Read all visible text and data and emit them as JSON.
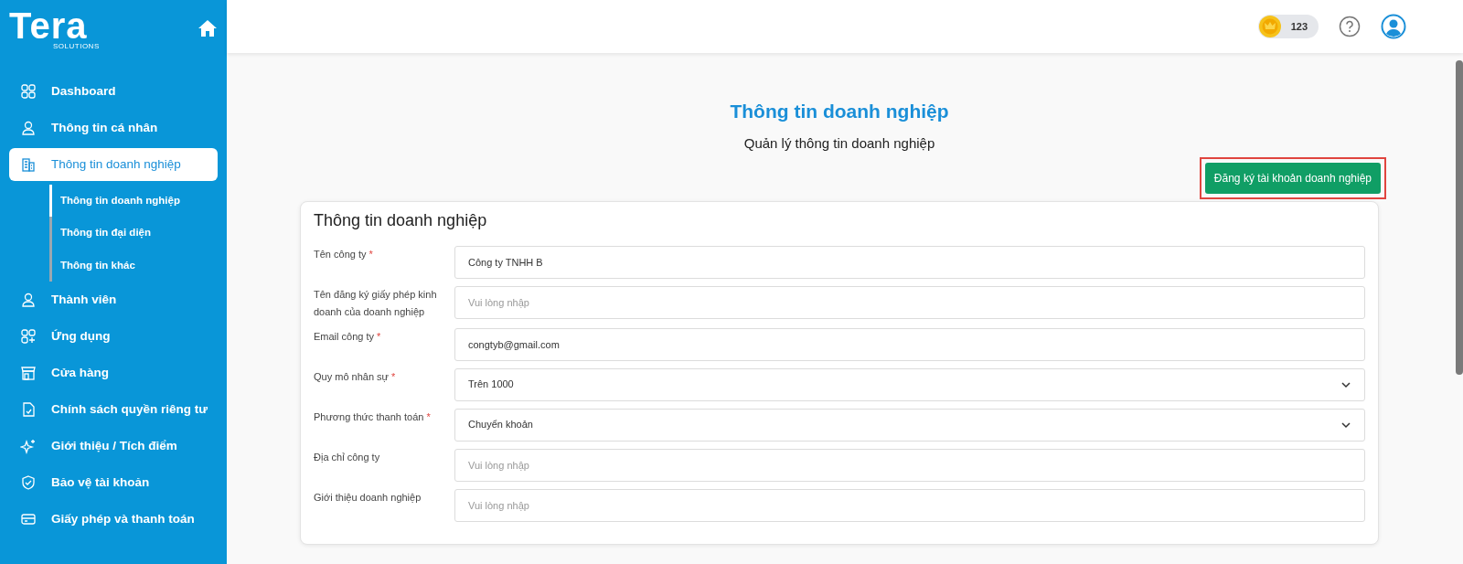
{
  "logo": {
    "text": "Tera",
    "tagline": "SOLUTIONS"
  },
  "sidebar": {
    "items": [
      {
        "label": "Dashboard",
        "kind": "grid",
        "selected": false
      },
      {
        "label": "Thông tin cá nhân",
        "kind": "person",
        "selected": false
      },
      {
        "label": "Thông tin doanh nghiệp",
        "kind": "building",
        "selected": true,
        "children": [
          {
            "label": "Thông tin doanh nghiệp",
            "selected": true
          },
          {
            "label": "Thông tin đại diện",
            "selected": false
          },
          {
            "label": "Thông tin khác",
            "selected": false
          }
        ]
      },
      {
        "label": "Thành viên",
        "kind": "person",
        "selected": false
      },
      {
        "label": "Ứng dụng",
        "kind": "apps",
        "selected": false
      },
      {
        "label": "Cửa hàng",
        "kind": "store",
        "selected": false
      },
      {
        "label": "Chính sách quyền riêng tư",
        "kind": "document",
        "selected": false
      },
      {
        "label": "Giới thiệu / Tích điểm",
        "kind": "sparkle",
        "selected": false
      },
      {
        "label": "Bảo vệ tài khoản",
        "kind": "shield",
        "selected": false
      },
      {
        "label": "Giấy phép và thanh toán",
        "kind": "card",
        "selected": false
      }
    ]
  },
  "header": {
    "points": "123"
  },
  "page": {
    "title": "Thông tin doanh nghiệp",
    "subtitle": "Quản lý thông tin doanh nghiệp"
  },
  "register_button": {
    "label": "Đăng ký tài khoản doanh nghiệp",
    "highlighted": true
  },
  "form": {
    "title": "Thông tin doanh nghiệp",
    "fields": [
      {
        "label": "Tên công ty",
        "required_mark": "*",
        "kind": "input",
        "value": "Công ty TNHH B"
      },
      {
        "label": "Tên đăng ký giấy phép kinh doanh của doanh nghiệp",
        "kind": "input",
        "placeholder": "Vui lòng nhập"
      },
      {
        "label": "Email công ty",
        "required_mark": "*",
        "kind": "input",
        "value": "congtyb@gmail.com"
      },
      {
        "label": "Quy mô nhân sự",
        "required_mark": "*",
        "kind": "select",
        "value": "Trên 1000"
      },
      {
        "label": "Phương thức thanh toán",
        "required_mark": "*",
        "kind": "select",
        "value": "Chuyển khoản"
      },
      {
        "label": "Địa chỉ công ty",
        "kind": "input",
        "placeholder": "Vui lòng nhập"
      },
      {
        "label": "Giới thiệu doanh nghiệp",
        "kind": "input",
        "placeholder": "Vui lòng nhập"
      }
    ]
  }
}
